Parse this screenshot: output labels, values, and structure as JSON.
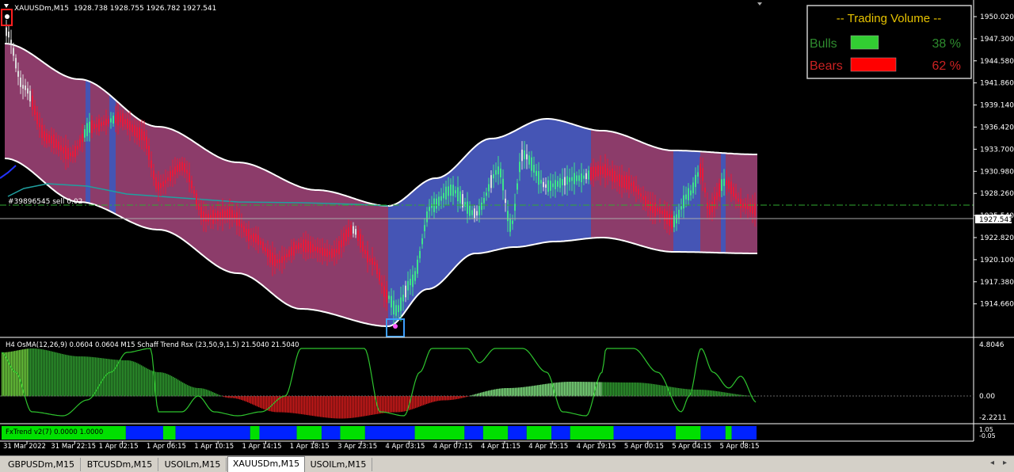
{
  "header": {
    "symbol": "XAUUSDm,M15",
    "ohlc": "1928.738 1928.755 1926.782 1927.541",
    "trade_label": "#39896545 sell 0.02"
  },
  "volume_panel": {
    "title": "-- Trading Volume --",
    "bulls_label": "Bulls",
    "bulls_pct": "38 %",
    "bulls_value": 38,
    "bears_label": "Bears",
    "bears_pct": "62 %",
    "bears_value": 62,
    "bulls_color": "#32cd32",
    "bears_color": "#ff0000"
  },
  "colors": {
    "band_pink": "#8c3c6a",
    "band_blue": "#4555b5",
    "bull_candle": "#3de38a",
    "bear_candle": "#e8193a",
    "neutral_candle": "#dcdcdc"
  },
  "price_axis": {
    "labels": [
      "1950.020",
      "1947.300",
      "1944.580",
      "1941.860",
      "1939.140",
      "1936.420",
      "1933.700",
      "1930.980",
      "1928.260",
      "1925.540",
      "1922.820",
      "1920.100",
      "1917.380",
      "1914.660"
    ],
    "current": "1927.541"
  },
  "indicator": {
    "label": "H4 OsMA(12,26,9) 0.0604 0.0604  M15 Schaff Trend Rsx (23,50,9,1.5) 21.5040 21.5040",
    "axis": [
      "4.8046",
      "0.00",
      "-2.2211"
    ]
  },
  "fxtrend": {
    "label": "FxTrend v2(7) 0.0000 1.0000",
    "axis_top": "1.05",
    "axis_bottom": "-0.05",
    "segments": [
      {
        "c": "g",
        "w": 20
      },
      {
        "c": "b",
        "w": 6
      },
      {
        "c": "g",
        "w": 2
      },
      {
        "c": "b",
        "w": 12
      },
      {
        "c": "g",
        "w": 1.5
      },
      {
        "c": "b",
        "w": 6
      },
      {
        "c": "g",
        "w": 4
      },
      {
        "c": "b",
        "w": 3
      },
      {
        "c": "g",
        "w": 4
      },
      {
        "c": "b",
        "w": 8
      },
      {
        "c": "g",
        "w": 8
      },
      {
        "c": "b",
        "w": 3
      },
      {
        "c": "g",
        "w": 4
      },
      {
        "c": "b",
        "w": 3
      },
      {
        "c": "g",
        "w": 4
      },
      {
        "c": "b",
        "w": 3
      },
      {
        "c": "g",
        "w": 7
      },
      {
        "c": "b",
        "w": 10
      },
      {
        "c": "g",
        "w": 4
      },
      {
        "c": "b",
        "w": 4
      },
      {
        "c": "g",
        "w": 1
      },
      {
        "c": "b",
        "w": 4
      }
    ]
  },
  "time_axis": [
    "31 Mar 2022",
    "31 Mar 22:15",
    "1 Apr 02:15",
    "1 Apr 06:15",
    "1 Apr 10:15",
    "1 Apr 14:15",
    "1 Apr 18:15",
    "3 Apr 23:15",
    "4 Apr 03:15",
    "4 Apr 07:15",
    "4 Apr 11:15",
    "4 Apr 15:15",
    "4 Apr 19:15",
    "5 Apr 00:15",
    "5 Apr 04:15",
    "5 Apr 08:15"
  ],
  "tabs": [
    "GBPUSDm,M15",
    "BTCUSDm,M15",
    "USOILm,M15",
    "XAUUSDm,M15",
    "USOILm,M15"
  ],
  "active_tab": 3,
  "scroll_icons": [
    "chevron-left-icon",
    "chevron-right-icon"
  ]
}
